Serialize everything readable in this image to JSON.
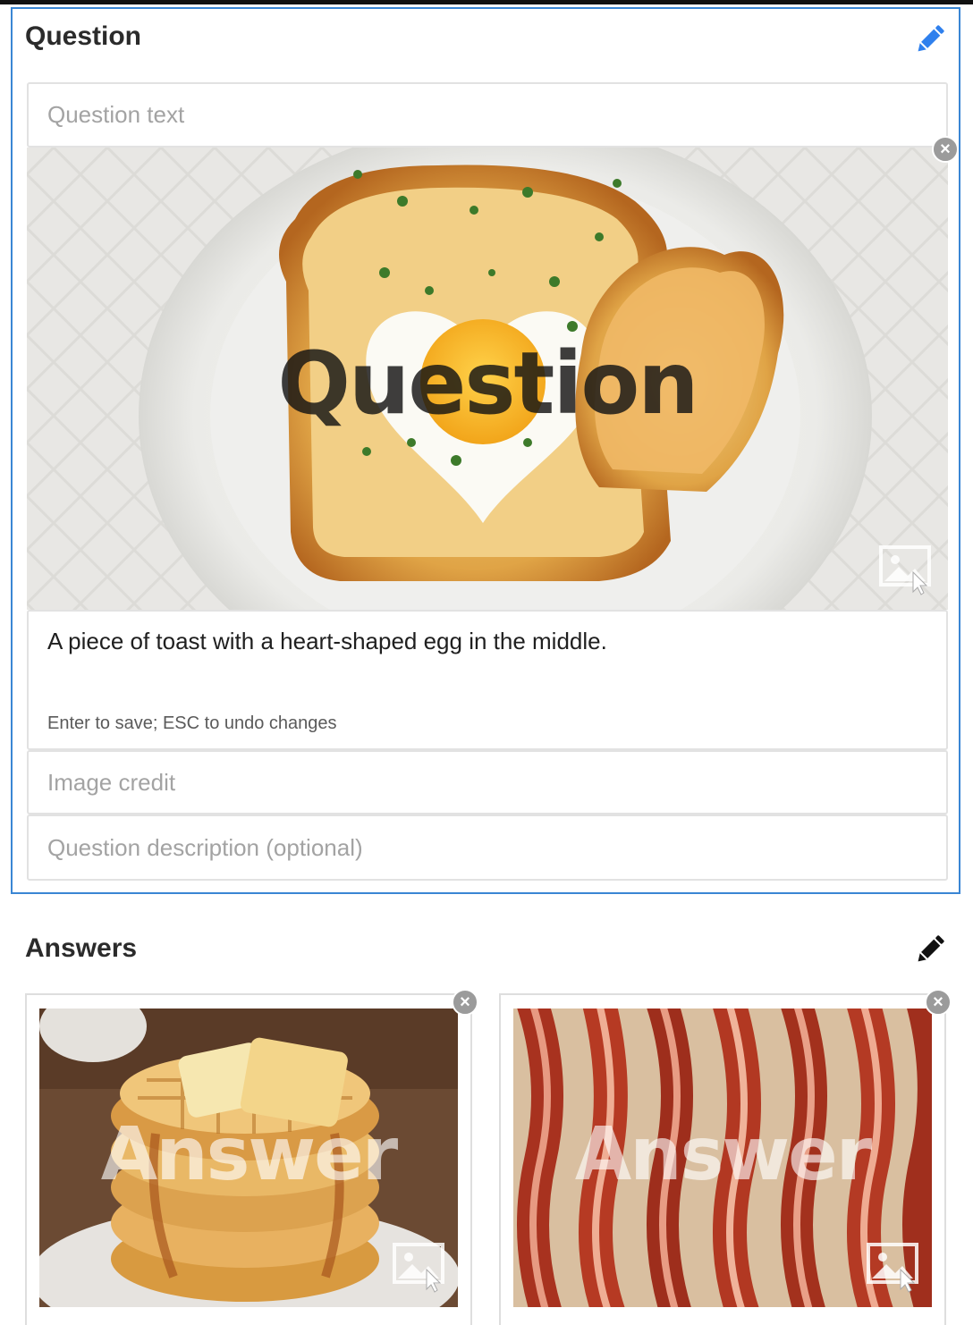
{
  "question_section": {
    "title": "Question",
    "edit_icon": "pencil-icon",
    "question_text_placeholder": "Question text",
    "image": {
      "description": "toast with heart-shaped egg",
      "overlay_label": "Question",
      "remove_icon": "close-icon",
      "replace_icon": "image-icon"
    },
    "alt_text": {
      "value": "A piece of toast with a heart-shaped egg in the middle.",
      "hint": "Enter to save; ESC to undo changes"
    },
    "image_credit_placeholder": "Image credit",
    "description_placeholder": "Question description (optional)"
  },
  "answers_section": {
    "title": "Answers",
    "edit_icon": "pencil-icon",
    "answers": [
      {
        "overlay_label": "Answer",
        "image_subject": "waffles with butter and syrup"
      },
      {
        "overlay_label": "Answer",
        "image_subject": "bacon strips"
      }
    ]
  },
  "colors": {
    "accent": "#3a86d4",
    "field_border": "#e2e2e2",
    "placeholder": "#a3a3a3"
  }
}
